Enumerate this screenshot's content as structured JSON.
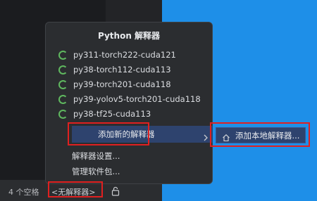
{
  "popup": {
    "title": "Python 解释器",
    "environments": [
      {
        "name": "py311-torch222-cuda121"
      },
      {
        "name": "py38-torch112-cuda113"
      },
      {
        "name": "py39-torch201-cuda118"
      },
      {
        "name": "py39-yolov5-torch201-cuda118"
      },
      {
        "name": "py38-tf25-cuda113"
      }
    ],
    "add_interpreter": "添加新的解释器",
    "interpreter_settings": "解释器设置...",
    "manage_packages": "管理软件包..."
  },
  "submenu": {
    "add_local": "添加本地解释器..."
  },
  "status_bar": {
    "indent": "4 个空格",
    "interpreter": "<无解释器>"
  },
  "colors": {
    "spinner": "#5fb85f",
    "selected_bg": "#2e436e",
    "highlight_box": "#e02020",
    "desktop": "#1e8fe8"
  }
}
